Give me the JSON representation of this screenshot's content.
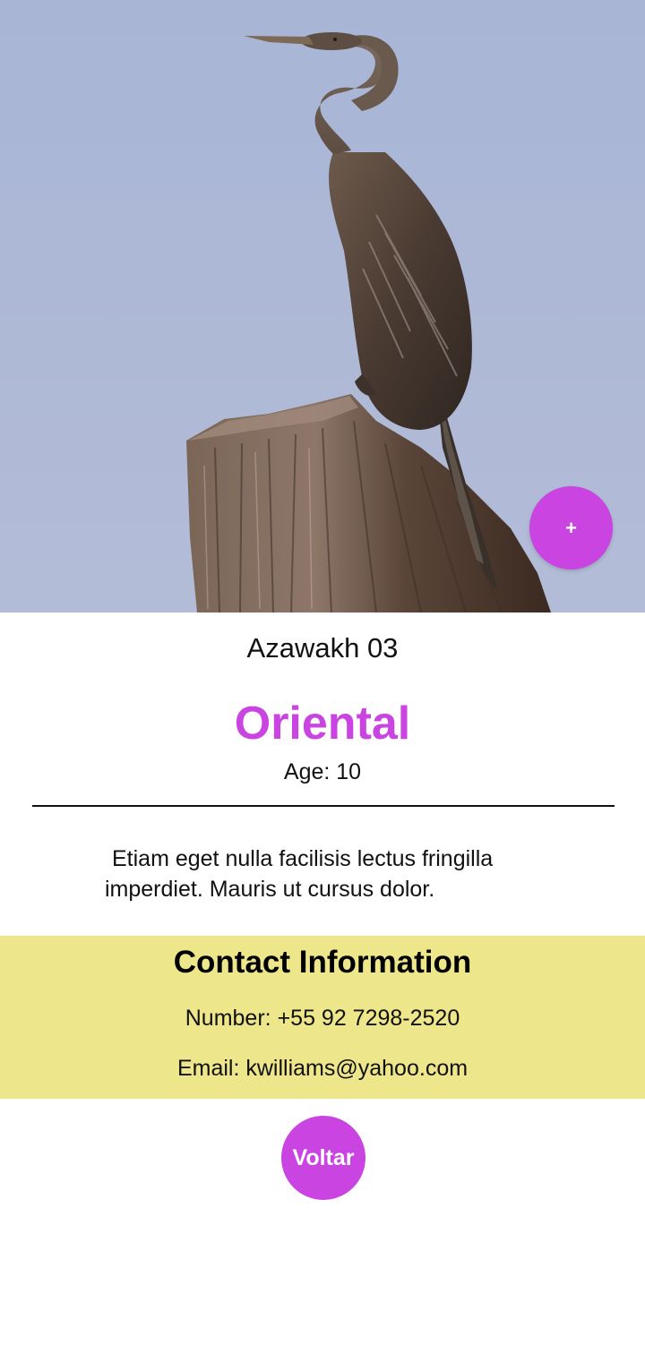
{
  "theme": {
    "accent": "#c944e0",
    "contact_bg": "#eee68b",
    "sky": "#aab7d6"
  },
  "hero": {
    "image_subject": "bird-perched-on-tree-stump",
    "add_button_label": "+"
  },
  "details": {
    "name": "Azawakh 03",
    "breed": "Oriental",
    "age_label": "Age:",
    "age_value": "10",
    "description": "Etiam eget nulla facilisis lectus fringilla imperdiet. Mauris ut cursus dolor."
  },
  "contact": {
    "title": "Contact Information",
    "number_label": "Number:",
    "number_value": "+55 92 7298-2520",
    "email_label": "Email:",
    "email_value": "kwilliams@yahoo.com"
  },
  "actions": {
    "back_label": "Voltar"
  }
}
